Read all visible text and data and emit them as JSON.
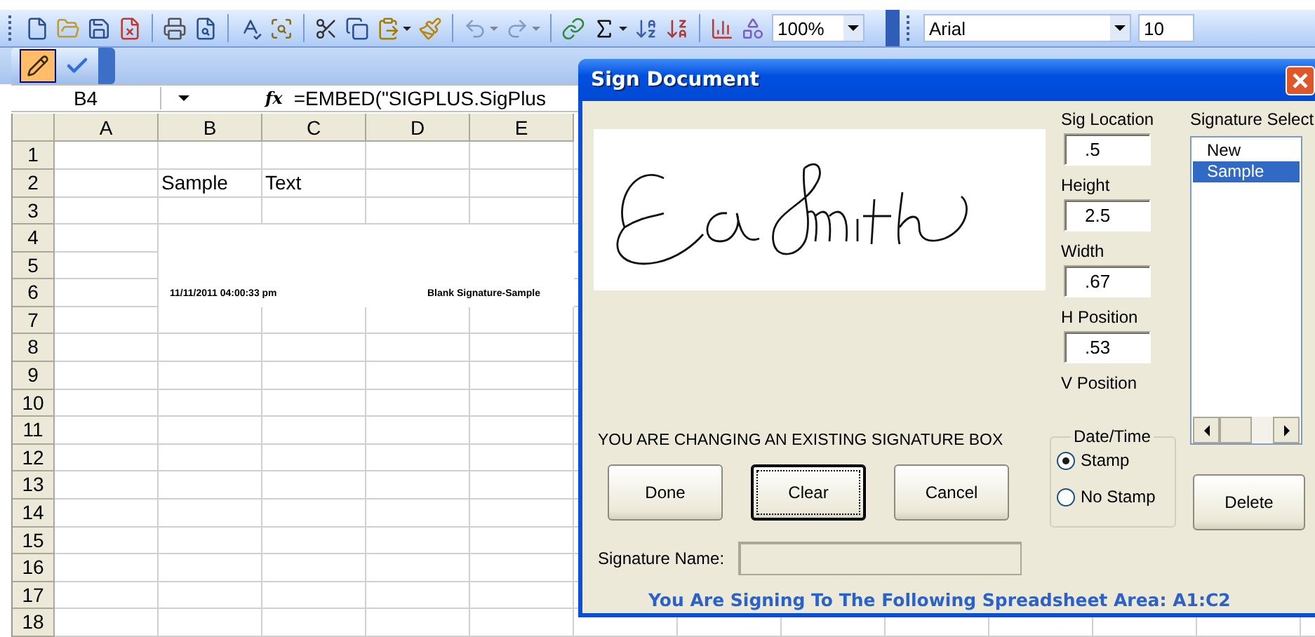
{
  "toolbar": {
    "undo": {
      "disabled": true
    },
    "redo": {
      "disabled": true
    },
    "zoom": "100%",
    "font": "Arial",
    "font_size": "10"
  },
  "sign_toolbar": {
    "buttons": [
      {
        "kind": "pen",
        "selected": true
      },
      {
        "kind": "check",
        "selected": false
      }
    ]
  },
  "formula_bar": {
    "cell_ref": "B4",
    "fx_label": "fx",
    "formula": "=EMBED(\"SIGPLUS.SigPlus"
  },
  "sheet": {
    "columns": [
      "A",
      "B",
      "C",
      "D",
      "E"
    ],
    "rows": [
      {
        "label": "1"
      },
      {
        "label": "2",
        "cells": [
          null,
          "Sample",
          "Text"
        ]
      },
      {
        "label": "3"
      },
      {
        "label": "4"
      },
      {
        "label": "5"
      },
      {
        "label": "6"
      },
      {
        "label": "7"
      },
      {
        "label": "8"
      },
      {
        "label": "9"
      },
      {
        "label": "10"
      },
      {
        "label": "11"
      },
      {
        "label": "12"
      },
      {
        "label": "13"
      },
      {
        "label": "14"
      },
      {
        "label": "15"
      },
      {
        "label": "16"
      },
      {
        "label": "17"
      },
      {
        "label": "18"
      }
    ],
    "embedded_signature": {
      "date_stamp": "11/11/2011 04:00:33 pm",
      "caption": "Blank Signature-Sample"
    }
  },
  "dialog": {
    "title": "Sign Document",
    "fields": [
      {
        "label": "Sig Location",
        "value": ".5"
      },
      {
        "label": "Height",
        "value": "2.5"
      },
      {
        "label": "Width",
        "value": ".67"
      },
      {
        "label": "H Position",
        "value": ".53"
      },
      {
        "label": "V Position"
      }
    ],
    "signature_list": {
      "label": "Signature Select",
      "items": [
        {
          "text": "New",
          "selected": false
        },
        {
          "text": "Sample",
          "selected": true
        }
      ]
    },
    "message": "YOU ARE CHANGING AN EXISTING SIGNATURE BOX",
    "buttons": [
      {
        "label": "Done",
        "focused": false
      },
      {
        "label": "Clear",
        "focused": true
      },
      {
        "label": "Cancel",
        "focused": false
      }
    ],
    "date_time": {
      "label": "Date/Time",
      "options": [
        {
          "label": "Stamp",
          "selected": true
        },
        {
          "label": "No Stamp",
          "selected": false
        }
      ]
    },
    "delete_button": "Delete",
    "signature_name": {
      "label": "Signature Name:",
      "disabled": true
    },
    "status": "You Are Signing To The Following Spreadsheet Area: A1:C2"
  }
}
